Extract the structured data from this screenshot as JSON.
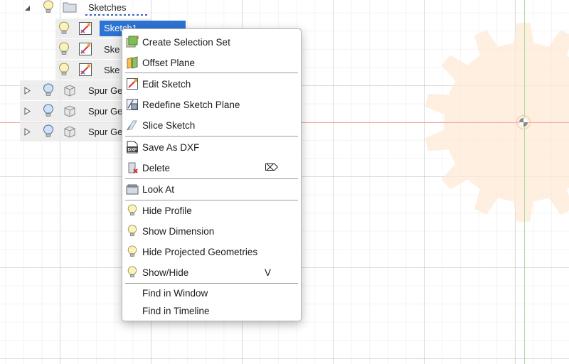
{
  "browser": {
    "sketches_folder": "Sketches",
    "sketch_rows": [
      {
        "label": "Sketch1"
      },
      {
        "label": "Ske"
      },
      {
        "label": "Ske"
      }
    ],
    "body_rows": [
      {
        "label": "Spur Ge"
      },
      {
        "label": "Spur Ge"
      },
      {
        "label": "Spur Ge"
      }
    ]
  },
  "context_menu": {
    "items": [
      {
        "label": "Create Selection Set",
        "icon": "selection-set-icon",
        "shortcut": ""
      },
      {
        "label": "Offset Plane",
        "icon": "offset-plane-icon",
        "shortcut": ""
      },
      {
        "label": "Edit Sketch",
        "icon": "edit-sketch-icon",
        "shortcut": ""
      },
      {
        "label": "Redefine Sketch Plane",
        "icon": "redefine-sketch-plane-icon",
        "shortcut": ""
      },
      {
        "label": "Slice Sketch",
        "icon": "slice-sketch-icon",
        "shortcut": ""
      },
      {
        "label": "Save As DXF",
        "icon": "dxf-file-icon",
        "shortcut": ""
      },
      {
        "label": "Delete",
        "icon": "delete-icon",
        "shortcut": "⌦"
      },
      {
        "label": "Look At",
        "icon": "look-at-icon",
        "shortcut": ""
      },
      {
        "label": "Hide Profile",
        "icon": "lightbulb-icon",
        "shortcut": ""
      },
      {
        "label": "Show Dimension",
        "icon": "lightbulb-icon",
        "shortcut": ""
      },
      {
        "label": "Hide Projected Geometries",
        "icon": "lightbulb-icon",
        "shortcut": ""
      },
      {
        "label": "Show/Hide",
        "icon": "lightbulb-icon",
        "shortcut": "V"
      },
      {
        "label": "Find in Window",
        "icon": "",
        "shortcut": ""
      },
      {
        "label": "Find in Timeline",
        "icon": "",
        "shortcut": ""
      }
    ]
  },
  "colors": {
    "selection": "#2d73d3",
    "gear_fill": "#fde9d6",
    "x_axis": "#f3a7a0",
    "z_axis": "#a8dea0"
  }
}
